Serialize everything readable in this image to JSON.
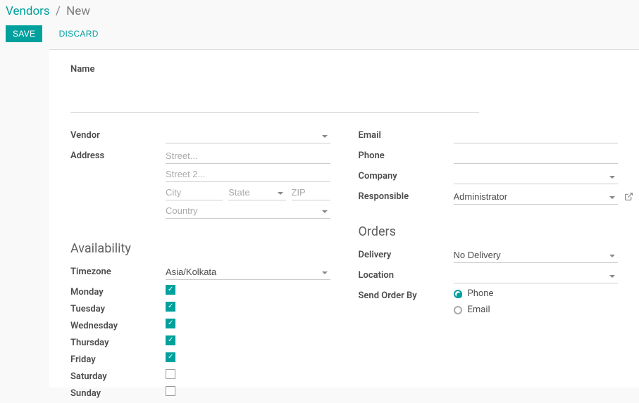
{
  "breadcrumb": {
    "root": "Vendors",
    "current": "New"
  },
  "actions": {
    "save": "SAVE",
    "discard": "DISCARD"
  },
  "name_section": {
    "label": "Name",
    "value": ""
  },
  "left_fields": {
    "vendor": {
      "label": "Vendor",
      "value": ""
    },
    "address": {
      "label": "Address",
      "street_ph": "Street...",
      "street2_ph": "Street 2...",
      "city_ph": "City",
      "state_ph": "State",
      "zip_ph": "ZIP",
      "country_ph": "Country"
    }
  },
  "right_fields": {
    "email": {
      "label": "Email",
      "value": ""
    },
    "phone": {
      "label": "Phone",
      "value": ""
    },
    "company": {
      "label": "Company",
      "value": ""
    },
    "responsible": {
      "label": "Responsible",
      "value": "Administrator"
    }
  },
  "availability": {
    "heading": "Availability",
    "timezone": {
      "label": "Timezone",
      "value": "Asia/Kolkata"
    },
    "days": [
      {
        "label": "Monday",
        "checked": true
      },
      {
        "label": "Tuesday",
        "checked": true
      },
      {
        "label": "Wednesday",
        "checked": true
      },
      {
        "label": "Thursday",
        "checked": true
      },
      {
        "label": "Friday",
        "checked": true
      },
      {
        "label": "Saturday",
        "checked": false
      },
      {
        "label": "Sunday",
        "checked": false
      }
    ]
  },
  "orders": {
    "heading": "Orders",
    "delivery": {
      "label": "Delivery",
      "value": "No Delivery"
    },
    "location": {
      "label": "Location",
      "value": ""
    },
    "send_order_by": {
      "label": "Send Order By",
      "options": [
        {
          "label": "Phone",
          "selected": true
        },
        {
          "label": "Email",
          "selected": false
        }
      ]
    }
  }
}
